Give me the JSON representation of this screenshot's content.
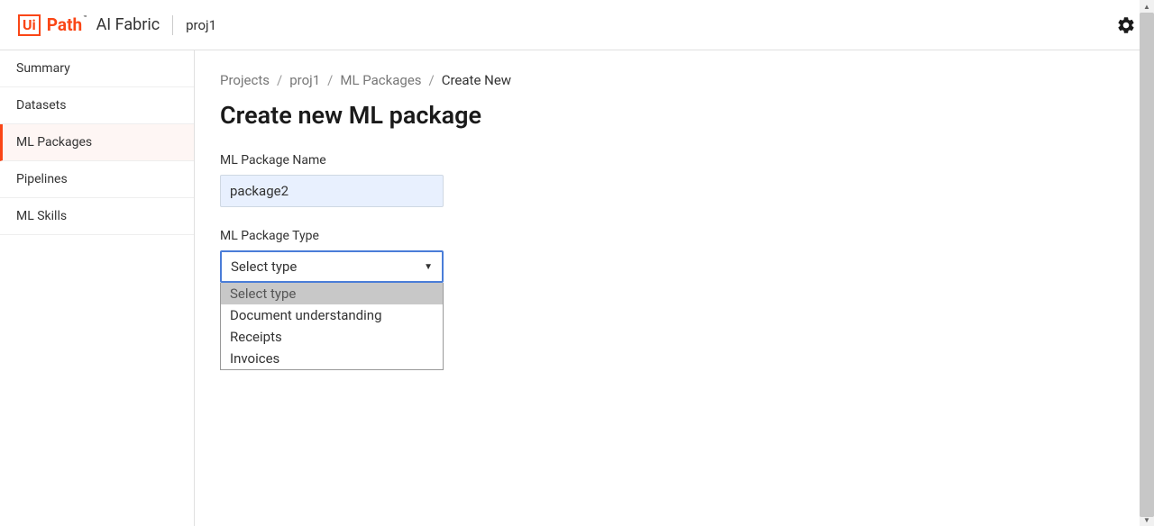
{
  "header": {
    "logo_ui": "Ui",
    "logo_path": "Path",
    "logo_tm": "™",
    "product_name": "AI Fabric",
    "project_name": "proj1"
  },
  "sidebar": {
    "items": [
      {
        "label": "Summary",
        "active": false
      },
      {
        "label": "Datasets",
        "active": false
      },
      {
        "label": "ML Packages",
        "active": true
      },
      {
        "label": "Pipelines",
        "active": false
      },
      {
        "label": "ML Skills",
        "active": false
      }
    ]
  },
  "breadcrumb": {
    "items": [
      {
        "label": "Projects",
        "current": false
      },
      {
        "label": "proj1",
        "current": false
      },
      {
        "label": "ML Packages",
        "current": false
      },
      {
        "label": "Create New",
        "current": true
      }
    ],
    "sep": "/"
  },
  "page": {
    "title": "Create new ML package"
  },
  "form": {
    "name_label": "ML Package Name",
    "name_value": "package2",
    "type_label": "ML Package Type",
    "type_selected": "Select type",
    "type_options": [
      {
        "label": "Select type",
        "placeholder": true
      },
      {
        "label": "Document understanding",
        "placeholder": false
      },
      {
        "label": "Receipts",
        "placeholder": false
      },
      {
        "label": "Invoices",
        "placeholder": false
      }
    ]
  }
}
